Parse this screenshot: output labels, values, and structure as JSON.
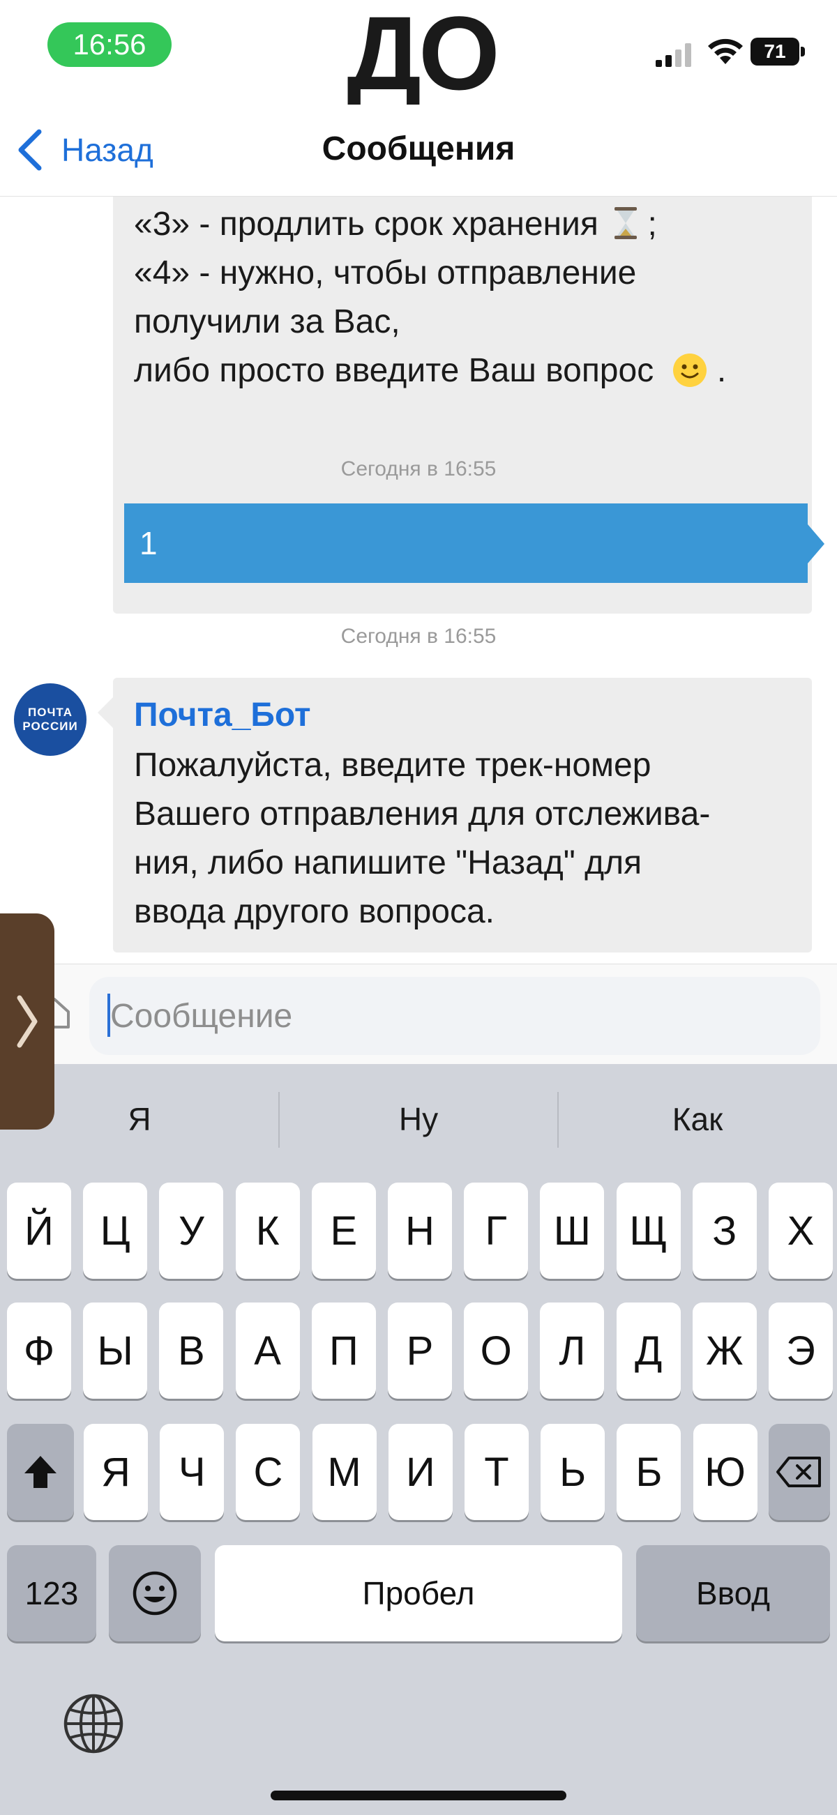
{
  "status_bar": {
    "time": "16:56",
    "overlay_label": "ДО",
    "battery": "71"
  },
  "nav": {
    "back_label": "Назад",
    "title": "Сообщения"
  },
  "messages": {
    "top_bubble_lines": [
      "«3» - продлить срок хранения",
      "«4» - нужно, чтобы отправление",
      "получили за Вас,",
      "либо просто введите Ваш вопрос"
    ],
    "top_bubble_line1_tail": ";",
    "top_bubble_line4_tail": ".",
    "timestamp_1": "Сегодня в 16:55",
    "user_message": "1",
    "timestamp_2": "Сегодня в 16:55",
    "avatar_text_1": "ПОЧТА",
    "avatar_text_2": "РОССИИ",
    "bot_name": "Почта_Бот",
    "bot_lines": [
      "Пожалуйста, введите трек-номер",
      "Вашего отправления для отслежива-",
      "ния, либо напишите \"Назад\" для",
      "ввода другого вопроса."
    ]
  },
  "input": {
    "placeholder": "Сообщение"
  },
  "keyboard": {
    "suggestions": [
      "Я",
      "Ну",
      "Как"
    ],
    "row1": [
      "Й",
      "Ц",
      "У",
      "К",
      "Е",
      "Н",
      "Г",
      "Ш",
      "Щ",
      "З",
      "Х"
    ],
    "row2": [
      "Ф",
      "Ы",
      "В",
      "А",
      "П",
      "Р",
      "О",
      "Л",
      "Д",
      "Ж",
      "Э"
    ],
    "row3": [
      "Я",
      "Ч",
      "С",
      "М",
      "И",
      "Т",
      "Ь",
      "Б",
      "Ю"
    ],
    "numbers_label": "123",
    "space_label": "Пробел",
    "return_label": "Ввод"
  },
  "colors": {
    "accent": "#1e6fd9",
    "outgoing_bubble": "#3a97d6",
    "incoming_bubble": "#ededed",
    "time_pill": "#34c759",
    "keyboard_bg": "#d1d4db"
  }
}
